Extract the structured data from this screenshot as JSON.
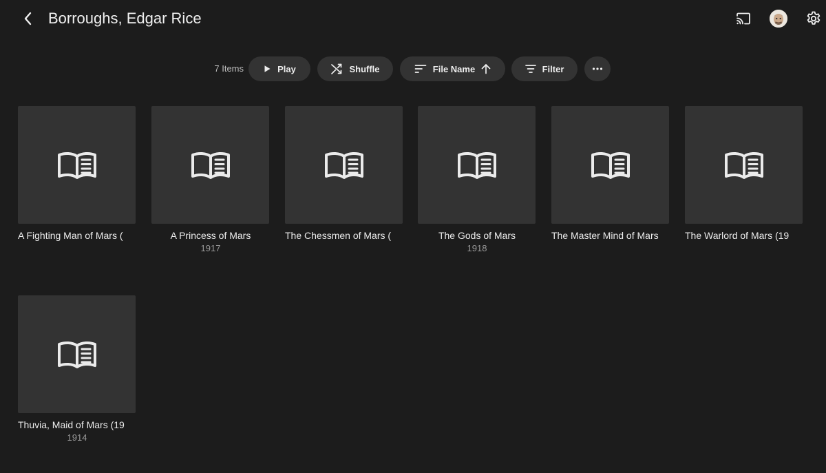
{
  "header": {
    "title": "Borroughs, Edgar Rice",
    "back_icon": "chevron-left-icon",
    "cast_icon": "cast-icon",
    "avatar_icon": "user-avatar",
    "settings_icon": "gear-icon"
  },
  "toolbar": {
    "item_count": "7 Items",
    "play_label": "Play",
    "shuffle_label": "Shuffle",
    "sort_label": "File Name",
    "sort_direction": "ascending",
    "filter_label": "Filter",
    "more_icon": "more-horizontal-icon"
  },
  "books": [
    {
      "title": "A Fighting Man of Mars (",
      "year": ""
    },
    {
      "title": "A Princess of Mars",
      "year": "1917"
    },
    {
      "title": "The Chessmen of Mars (",
      "year": ""
    },
    {
      "title": "The Gods of Mars",
      "year": "1918"
    },
    {
      "title": "The Master Mind of Mars",
      "year": ""
    },
    {
      "title": "The Warlord of Mars (19",
      "year": ""
    },
    {
      "title": "Thuvia, Maid of Mars (19",
      "year": "1914"
    }
  ],
  "colors": {
    "background": "#1c1c1c",
    "card": "#333333",
    "pill": "#333333",
    "text": "#ececec",
    "muted": "#9a9a9a"
  }
}
